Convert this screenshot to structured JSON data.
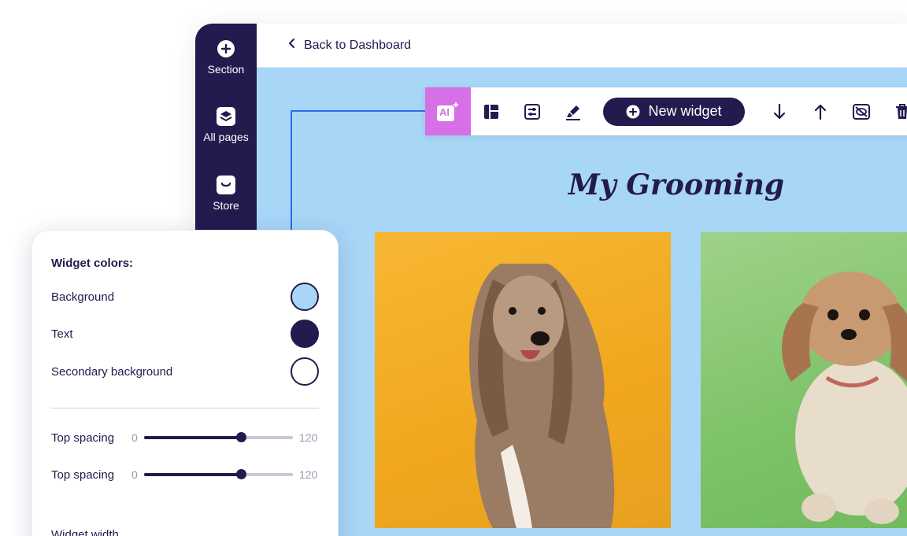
{
  "sidebar": {
    "items": [
      {
        "label": "Section",
        "icon": "plus-circle-icon"
      },
      {
        "label": "All pages",
        "icon": "layers-icon"
      },
      {
        "label": "Store",
        "icon": "bag-icon"
      }
    ]
  },
  "topbar": {
    "back_label": "Back to Dashboard"
  },
  "toolbar": {
    "ai_label": "AI",
    "new_widget_label": "New widget"
  },
  "page": {
    "title": "My Grooming"
  },
  "panel": {
    "title": "Widget colors:",
    "colors": [
      {
        "label": "Background",
        "color": "#a8d6f7"
      },
      {
        "label": "Text",
        "color": "#231a4e"
      },
      {
        "label": "Secondary background",
        "color": "#ffffff"
      }
    ],
    "sliders": [
      {
        "label": "Top spacing",
        "min": "0",
        "max": "120",
        "value_fraction": 0.65
      },
      {
        "label": "Top spacing",
        "min": "0",
        "max": "120",
        "value_fraction": 0.65
      }
    ],
    "next_label": "Widget width"
  },
  "colors": {
    "accent": "#231a4e",
    "canvas": "#a8d6f7",
    "ai": "#d76fe6",
    "connector": "#2f6df0"
  }
}
